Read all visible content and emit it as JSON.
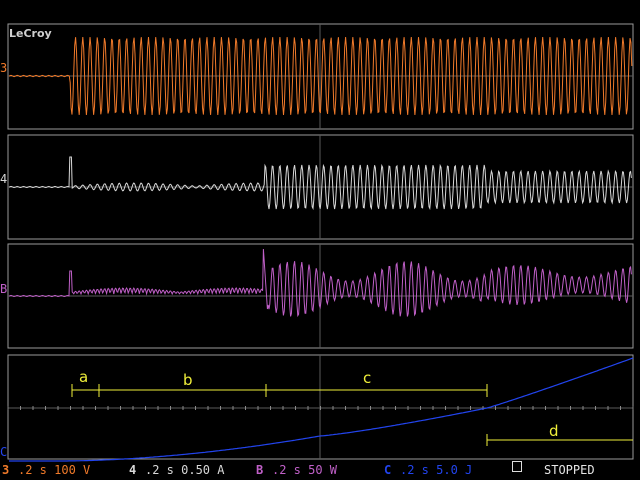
{
  "scope": {
    "brand_logo": "LeCroy",
    "colors": {
      "ch3": "#f07a2a",
      "ch4": "#d8d8d8",
      "chB": "#c060c8",
      "chC": "#2244ee",
      "cursor": "#f0ef3a",
      "frame": "#9a9a9a",
      "grid": "#5a5a5a"
    },
    "trace_markers": {
      "ch3": "3",
      "ch4": "4",
      "chB": "B",
      "chC": "C"
    },
    "segment_labels": {
      "a": "a",
      "b": "b",
      "c": "c",
      "d": "d"
    }
  },
  "statusbar": {
    "ch3": {
      "marker": "3",
      "text": ".2 s 100 V",
      "color": "#f07a2a"
    },
    "ch4": {
      "marker": "4",
      "text": ".2 s 0.50 A",
      "color": "#d8d8d8"
    },
    "chB": {
      "marker": "B",
      "text": ".2 s 50 W",
      "color": "#c060c8"
    },
    "chC": {
      "marker": "C",
      "text": ".2 s 5.0 J",
      "color": "#2244ee"
    },
    "acquisition_state": "STOPPED"
  }
}
